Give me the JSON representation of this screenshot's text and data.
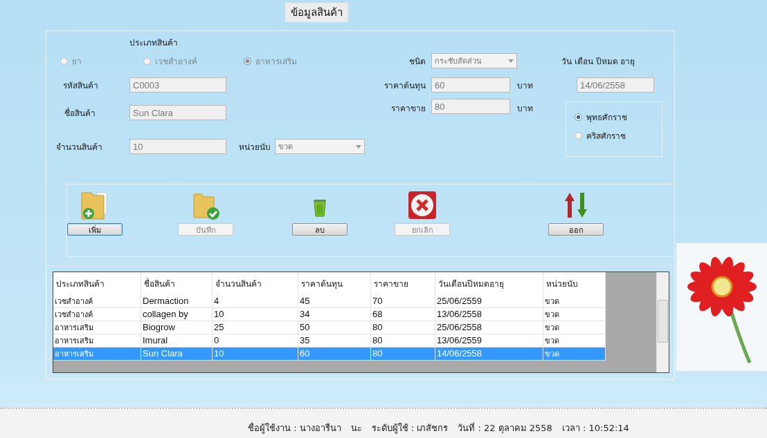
{
  "window": {
    "title": "ข้อมูลสินค้า"
  },
  "product_type": {
    "label": "ประเภทสินค้า",
    "options": [
      {
        "label": "ยา",
        "selected": false,
        "disabled": true
      },
      {
        "label": "เวชสำอางค์",
        "selected": false,
        "disabled": true
      },
      {
        "label": "อาหารเสริม",
        "selected": true,
        "disabled": true
      }
    ]
  },
  "fields": {
    "code": {
      "label": "รหัสสินค้า",
      "value": "C0003"
    },
    "name": {
      "label": "ชื่อสินค้า",
      "value": "Sun Clara"
    },
    "quantity": {
      "label": "จำนวนสินค้า",
      "value": "10"
    },
    "unit": {
      "label": "หน่วยนับ",
      "value": "ขวด"
    },
    "kind": {
      "label": "ชนิด",
      "value": "กระชับสัดส่วน"
    },
    "cost": {
      "label": "ราคาต้นทุน",
      "value": "60",
      "suffix": "บาท"
    },
    "price": {
      "label": "ราคาขาย",
      "value": "80",
      "suffix": "บาท"
    },
    "expiry": {
      "label": "วัน เดือน ปีหมด อายุ",
      "value": "14/06/2558"
    }
  },
  "era_options": [
    {
      "label": "พุทธศักราช",
      "selected": true
    },
    {
      "label": "คริสศักราช",
      "selected": false
    }
  ],
  "actions": [
    {
      "label": "เพิ่ม",
      "kind": "add",
      "disabled": false,
      "focused": true
    },
    {
      "label": "บันทึก",
      "kind": "save",
      "disabled": true,
      "focused": false
    },
    {
      "label": "ลบ",
      "kind": "delete",
      "disabled": false,
      "focused": false
    },
    {
      "label": "ยกเลิก",
      "kind": "cancel",
      "disabled": true,
      "focused": false
    },
    {
      "label": "ออก",
      "kind": "exit",
      "disabled": false,
      "focused": false
    }
  ],
  "table": {
    "columns": [
      "ประเภทสินค้า",
      "ชื่อสินค้า",
      "จำนวนสินค้า",
      "ราคาต้นทุน",
      "ราคาขาย",
      "วันเดือนปีหมดอายุ",
      "หน่วยนับ"
    ],
    "rows": [
      {
        "cells": [
          "เวชสำอางค์",
          "Dermaction",
          "4",
          "45",
          "70",
          "25/06/2559",
          "ขวด"
        ],
        "selected": false
      },
      {
        "cells": [
          "เวชสำอางค์",
          "collagen by",
          "10",
          "34",
          "68",
          "13/06/2558",
          "ขวด"
        ],
        "selected": false
      },
      {
        "cells": [
          "อาหารเสริม",
          "Biogrow",
          "25",
          "50",
          "80",
          "25/06/2558",
          "ขวด"
        ],
        "selected": false
      },
      {
        "cells": [
          "อาหารเสริม",
          "Imural",
          "0",
          "35",
          "80",
          "13/06/2559",
          "ขวด"
        ],
        "selected": false
      },
      {
        "cells": [
          "อาหารเสริม",
          "Sun Clara",
          "10",
          "60",
          "80",
          "14/06/2558",
          "ขวด"
        ],
        "selected": true
      }
    ]
  },
  "status_bar": [
    "ชื่อผู้ใช้งาน : นางอารีนา",
    "นะ",
    "ระดับผู้ใช้ : เภสัชกร",
    "วันที่ : 22 ตุลาคม 2558",
    "เวลา : 10:52:14"
  ]
}
